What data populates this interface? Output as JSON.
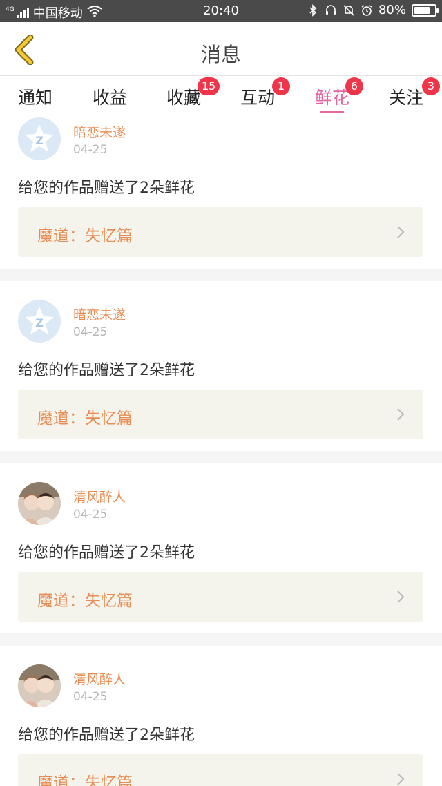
{
  "status_bar": {
    "network": "4G",
    "carrier": "中国移动",
    "time": "20:40",
    "battery": "80%",
    "battery_level": 0.8
  },
  "header": {
    "title": "消息"
  },
  "tabs": [
    {
      "label": "通知",
      "badge": "",
      "active": false
    },
    {
      "label": "收益",
      "badge": "",
      "active": false
    },
    {
      "label": "收藏",
      "badge": "15",
      "active": false
    },
    {
      "label": "互动",
      "badge": "1",
      "active": false
    },
    {
      "label": "鲜花",
      "badge": "6",
      "active": true
    },
    {
      "label": "关注",
      "badge": "3",
      "active": false
    }
  ],
  "messages": [
    {
      "user": "暗恋未遂",
      "date": "04-25",
      "text": "给您的作品赠送了2朵鲜花",
      "work": "魔道：失忆篇",
      "avatar": "default-avatar"
    },
    {
      "user": "暗恋未遂",
      "date": "04-25",
      "text": "给您的作品赠送了2朵鲜花",
      "work": "魔道：失忆篇",
      "avatar": "default-avatar"
    },
    {
      "user": "清风醉人",
      "date": "04-25",
      "text": "给您的作品赠送了2朵鲜花",
      "work": "魔道：失忆篇",
      "avatar": "photo-avatar"
    },
    {
      "user": "清风醉人",
      "date": "04-25",
      "text": "给您的作品赠送了2朵鲜花",
      "work": "魔道：失忆篇",
      "avatar": "photo-avatar"
    }
  ],
  "colors": {
    "accent": "#e667a0",
    "badge": "#f0344a",
    "username": "#e88c52",
    "back_arrow": "#f5c930"
  }
}
